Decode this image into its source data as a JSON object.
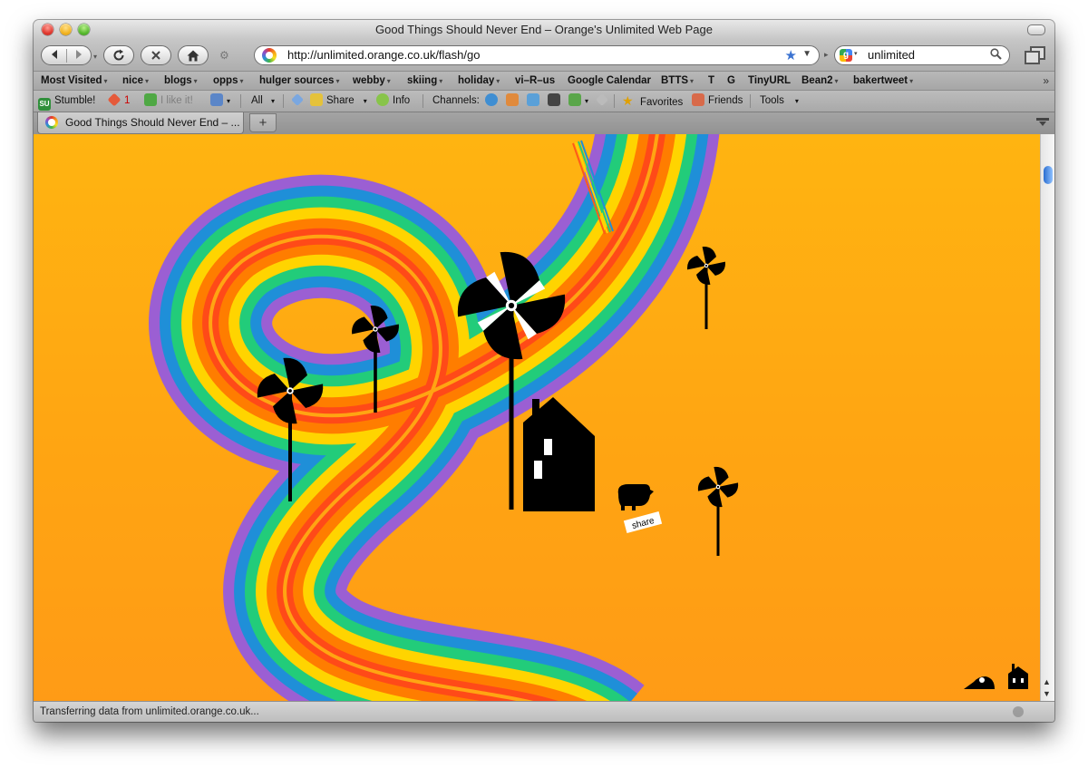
{
  "window": {
    "title": "Good Things Should Never End – Orange's Unlimited Web Page"
  },
  "toolbar": {
    "url": "http://unlimited.orange.co.uk/flash/go",
    "search_value": "unlimited"
  },
  "bookmarks": {
    "items": [
      {
        "label": "Most Visited",
        "caret": "▾"
      },
      {
        "label": "nice",
        "caret": "▾"
      },
      {
        "label": "blogs",
        "caret": "▾"
      },
      {
        "label": "opps",
        "caret": "▾"
      },
      {
        "label": "hulger sources",
        "caret": "▾"
      },
      {
        "label": "webby",
        "caret": "▾"
      },
      {
        "label": "skiing",
        "caret": "▾"
      },
      {
        "label": "holiday",
        "caret": "▾"
      },
      {
        "label": "vi–R–us",
        "caret": ""
      },
      {
        "label": "Google Calendar",
        "caret": ""
      },
      {
        "label": "BTTS",
        "caret": "▾"
      },
      {
        "label": "T",
        "caret": ""
      },
      {
        "label": "G",
        "caret": ""
      },
      {
        "label": "TinyURL",
        "caret": ""
      },
      {
        "label": "Bean2",
        "caret": "▾"
      },
      {
        "label": "bakertweet",
        "caret": "▾"
      }
    ],
    "overflow": "»"
  },
  "stumble": {
    "stumble_label": "Stumble!",
    "like_count": "1",
    "like_label": "I like it!",
    "all_label": "All",
    "share_label": "Share",
    "info_label": "Info",
    "channels_label": "Channels:",
    "favorites_label": "Favorites",
    "friends_label": "Friends",
    "tools_label": "Tools",
    "su_badge": "SU"
  },
  "tabs": [
    {
      "label": "Good Things Should Never End – ..."
    }
  ],
  "newtab_label": "+",
  "page": {
    "share_tag": "share"
  },
  "status": {
    "text": "Transferring data from unlimited.orange.co.uk..."
  },
  "colors": {
    "background": "#ffa512",
    "rainbow": [
      "#ff5b18",
      "#ff7d00",
      "#ffd400",
      "#22cc7a",
      "#1f8fd8",
      "#9b5fd3"
    ]
  }
}
